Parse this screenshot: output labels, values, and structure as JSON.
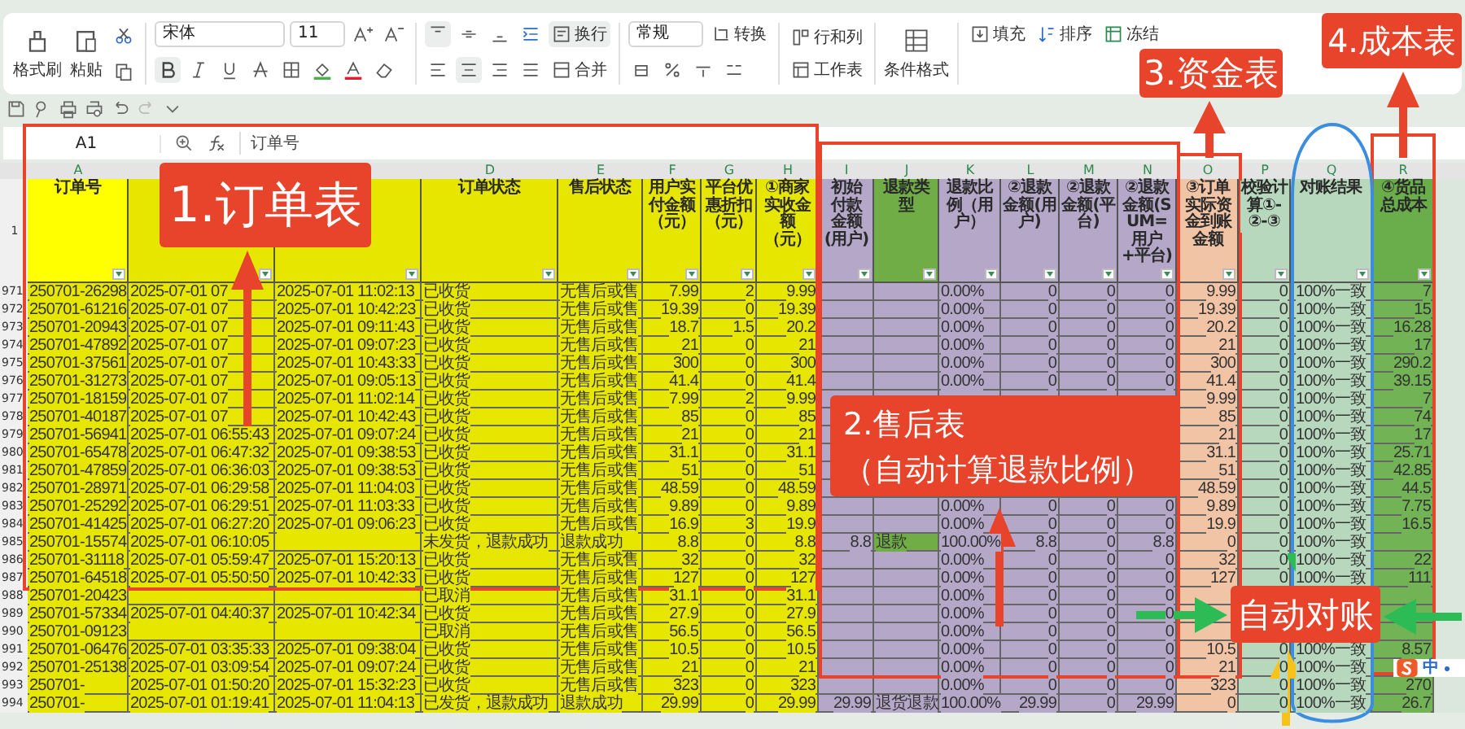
{
  "ribbon": {
    "format_painter": "格式刷",
    "paste": "粘贴",
    "font_name": "宋体",
    "font_size": "11",
    "wrap": "换行",
    "merge": "合并",
    "number_format": "常规",
    "convert": "转换",
    "rows_cols": "行和列",
    "worksheet": "工作表",
    "conditional": "条件格式",
    "fill": "填充",
    "sort": "排序",
    "freeze": "冻结"
  },
  "formula_bar": {
    "cell": "A1",
    "content": "订单号"
  },
  "sheet": {
    "header_row": "1",
    "columns": [
      {
        "letter": "A",
        "header": "订单号",
        "kind": "text"
      },
      {
        "kind": "text"
      },
      {
        "kind": "text"
      },
      {
        "letter": "D",
        "header": "订单状态",
        "kind": "text"
      },
      {
        "letter": "E",
        "header": "售后状态",
        "kind": "text"
      },
      {
        "letter": "F",
        "header": "用户实付金额（元）",
        "kind": "number"
      },
      {
        "letter": "G",
        "header": "平台优惠折扣（元）",
        "kind": "number"
      },
      {
        "letter": "H",
        "header": "①商家实收金额（元）",
        "kind": "number"
      },
      {
        "letter": "I",
        "header": "初始付款金额(用户)",
        "kind": "number"
      },
      {
        "letter": "J",
        "header": "退款类型",
        "kind": "text"
      },
      {
        "letter": "K",
        "header": "退款比例（用户）",
        "kind": "text"
      },
      {
        "letter": "L",
        "header": "②退款金额(用户)",
        "kind": "number"
      },
      {
        "letter": "M",
        "header": "②退款金额(平台)",
        "kind": "number"
      },
      {
        "letter": "N",
        "header": "②退款金额(SUM=用户+平台)",
        "kind": "number"
      },
      {
        "letter": "O",
        "header": "③订单实际资金到账金额",
        "kind": "number"
      },
      {
        "letter": "P",
        "header": "校验计算①-②-③",
        "kind": "number"
      },
      {
        "letter": "Q",
        "header": "对账结果",
        "kind": "text"
      },
      {
        "letter": "R",
        "header": "④货品总成本",
        "kind": "number"
      }
    ],
    "rows": [
      {
        "num": "971",
        "flagged": false,
        "cells": [
          "250701-26298",
          "2025-07-01 07",
          "2025-07-01 11:02:13",
          "已收货",
          "无售后或售",
          "7.99",
          "2",
          "9.99",
          null,
          null,
          "0.00%",
          "0",
          "0",
          "0",
          "9.99",
          "0",
          "100%一致",
          "7"
        ]
      },
      {
        "num": "972",
        "flagged": false,
        "cells": [
          "250701-61216",
          "2025-07-01 07",
          "2025-07-01 10:42:23",
          "已收货",
          "无售后或售",
          "19.39",
          "0",
          "19.39",
          null,
          null,
          "0.00%",
          "0",
          "0",
          "0",
          "19.39",
          "0",
          "100%一致",
          "15"
        ]
      },
      {
        "num": "973",
        "flagged": false,
        "cells": [
          "250701-20943",
          "2025-07-01 07",
          "2025-07-01 09:11:43",
          "已收货",
          "无售后或售",
          "18.7",
          "1.5",
          "20.2",
          null,
          null,
          "0.00%",
          "0",
          "0",
          "0",
          "20.2",
          "0",
          "100%一致",
          "16.28"
        ]
      },
      {
        "num": "974",
        "flagged": false,
        "cells": [
          "250701-47892",
          "2025-07-01 07",
          "2025-07-01 09:07:23",
          "已收货",
          "无售后或售",
          "21",
          "0",
          "21",
          null,
          null,
          "0.00%",
          "0",
          "0",
          "0",
          "21",
          "0",
          "100%一致",
          "17"
        ]
      },
      {
        "num": "975",
        "flagged": false,
        "cells": [
          "250701-37561",
          "2025-07-01 07",
          "2025-07-01 10:43:33",
          "已收货",
          "无售后或售",
          "300",
          "0",
          "300",
          null,
          null,
          "0.00%",
          "0",
          "0",
          "0",
          "300",
          "0",
          "100%一致",
          "290.2"
        ]
      },
      {
        "num": "976",
        "flagged": false,
        "cells": [
          "250701-31273",
          "2025-07-01 07",
          "2025-07-01 09:05:13",
          "已收货",
          "无售后或售",
          "41.4",
          "0",
          "41.4",
          null,
          null,
          "0.00%",
          "0",
          "0",
          "0",
          "41.4",
          "0",
          "100%一致",
          "39.15"
        ]
      },
      {
        "num": "977",
        "flagged": false,
        "cells": [
          "250701-18159",
          "2025-07-01 07",
          "2025-07-01 11:02:14",
          "已收货",
          "无售后或售",
          "7.99",
          "2",
          "9.99",
          null,
          null,
          null,
          null,
          null,
          null,
          "9.99",
          "0",
          "100%一致",
          "7"
        ]
      },
      {
        "num": "978",
        "cells": [
          "250701-40187",
          "2025-07-01 07",
          "2025-07-01 10:42:43",
          "已收货",
          "无售后或售",
          "85",
          "0",
          "85",
          null,
          null,
          null,
          null,
          null,
          null,
          "85",
          "0",
          "100%一致",
          "74"
        ]
      },
      {
        "num": "979",
        "cells": [
          "250701-56941",
          "2025-07-01 06:55:43",
          "2025-07-01 09:07:24",
          "已收货",
          "无售后或售",
          "21",
          "0",
          "21",
          null,
          null,
          null,
          null,
          null,
          null,
          "21",
          "0",
          "100%一致",
          "17"
        ]
      },
      {
        "num": "980",
        "cells": [
          "250701-65478",
          "2025-07-01 06:47:32",
          "2025-07-01 09:38:53",
          "已收货",
          "无售后或售",
          "31.1",
          "0",
          "31.1",
          null,
          null,
          null,
          null,
          null,
          null,
          "31.1",
          "0",
          "100%一致",
          "25.71"
        ]
      },
      {
        "num": "981",
        "cells": [
          "250701-47859",
          "2025-07-01 06:36:03",
          "2025-07-01 09:38:53",
          "已收货",
          "无售后或售",
          "51",
          "0",
          "51",
          null,
          null,
          null,
          null,
          null,
          null,
          "51",
          "0",
          "100%一致",
          "42.85"
        ]
      },
      {
        "num": "982",
        "cells": [
          "250701-28971",
          "2025-07-01 06:29:58",
          "2025-07-01 11:04:03",
          "已收货",
          "无售后或售",
          "48.59",
          "0",
          "48.59",
          null,
          null,
          null,
          null,
          null,
          null,
          "48.59",
          "0",
          "100%一致",
          "44.5"
        ]
      },
      {
        "num": "983",
        "flagged": false,
        "cells": [
          "250701-25292",
          "2025-07-01 06:29:51",
          "2025-07-01 11:03:33",
          "已收货",
          "无售后或售",
          "9.89",
          "0",
          "9.89",
          null,
          null,
          "0.00%",
          "0",
          "0",
          "0",
          "9.89",
          "0",
          "100%一致",
          "7.75"
        ]
      },
      {
        "num": "984",
        "flagged": false,
        "cells": [
          "250701-41425",
          "2025-07-01 06:27:20",
          "2025-07-01 09:06:23",
          "已收货",
          "无售后或售",
          "16.9",
          "3",
          "19.9",
          null,
          null,
          "0.00%",
          "0",
          "0",
          "0",
          "19.9",
          "0",
          "100%一致",
          "16.5"
        ]
      },
      {
        "num": "985",
        "flagged": true,
        "cells": [
          "250701-15574",
          "2025-07-01 06:10:05",
          null,
          "未发货，退款成功",
          "退款成功",
          "8.8",
          "0",
          "8.8",
          "8.8",
          "退款",
          "100.00%",
          "8.8",
          "0",
          "8.8",
          "0",
          "0",
          "100%一致",
          null
        ]
      },
      {
        "num": "986",
        "flagged": false,
        "cells": [
          "250701-31118",
          "2025-07-01 05:59:47",
          "2025-07-01 15:20:13",
          "已收货",
          "无售后或售",
          "32",
          "0",
          "32",
          null,
          null,
          "0.00%",
          "0",
          "0",
          "0",
          "32",
          "0",
          "100%一致",
          "22"
        ]
      },
      {
        "num": "987",
        "flagged": false,
        "cells": [
          "250701-64518",
          "2025-07-01 05:50:50",
          "2025-07-01 10:42:33",
          "已收货",
          "无售后或售",
          "127",
          "0",
          "127",
          null,
          null,
          "0.00%",
          "0",
          "0",
          "0",
          "127",
          "0",
          "100%一致",
          "111"
        ]
      },
      {
        "num": "988",
        "flagged": false,
        "cells": [
          "250701-20423",
          null,
          null,
          "已取消",
          "无售后或售",
          "31.1",
          "0",
          "31.1",
          null,
          null,
          "0.00%",
          "0",
          "0",
          "0",
          null,
          null,
          null,
          null
        ]
      },
      {
        "num": "989",
        "flagged": false,
        "cells": [
          "250701-57334",
          "2025-07-01 04:40:37",
          "2025-07-01 10:42:34",
          "已收货",
          "无售后或售",
          "27.9",
          "0",
          "27.9",
          null,
          null,
          "0.00%",
          "0",
          "0",
          "0",
          null,
          null,
          null,
          null
        ]
      },
      {
        "num": "990",
        "flagged": false,
        "cells": [
          "250701-09123",
          null,
          null,
          "已取消",
          "无售后或售",
          "56.5",
          "0",
          "56.5",
          null,
          null,
          "0.00%",
          "0",
          "0",
          "0",
          null,
          null,
          null,
          null
        ]
      },
      {
        "num": "991",
        "flagged": false,
        "cells": [
          "250701-06476",
          "2025-07-01 03:35:33",
          "2025-07-01 09:38:04",
          "已收货",
          "无售后或售",
          "10.5",
          "0",
          "10.5",
          null,
          null,
          "0.00%",
          "0",
          "0",
          "0",
          "10.5",
          "0",
          "100%一致",
          "8.57"
        ]
      },
      {
        "num": "992",
        "flagged": false,
        "cells": [
          "250701-25138",
          "2025-07-01 03:09:54",
          "2025-07-01 09:07:24",
          "已收货",
          "无售后或售",
          "21",
          "0",
          "21",
          null,
          null,
          "0.00%",
          "0",
          "0",
          "0",
          "21",
          "0",
          "100%一致",
          null
        ]
      },
      {
        "num": "993",
        "flagged": false,
        "cells": [
          "250701-",
          "2025-07-01 01:50:20",
          "2025-07-01 15:32:23",
          "已收货",
          "无售后或售",
          "323",
          "0",
          "323",
          null,
          null,
          "0.00%",
          "0",
          "0",
          "0",
          "323",
          "0",
          "100%一致",
          "270"
        ]
      },
      {
        "num": "994",
        "flagged": false,
        "cells": [
          "250701-",
          "2025-07-01 01:19:41",
          "2025-07-01 11:04:13",
          "已发货，退款成功",
          "退款成功",
          "29.99",
          "0",
          "29.99",
          "29.99",
          "退货退款",
          "100.00%",
          "29.99",
          "0",
          "29.99",
          "0",
          "0",
          "100%一致",
          "26.7"
        ]
      }
    ]
  },
  "annotations": [
    {
      "text": "1.订单表"
    },
    {
      "text": "2.售后表",
      "note": "（自动计算退款比例）"
    },
    {
      "text": "3.资金表"
    },
    {
      "text": "4.成本表"
    },
    {
      "text": "自动对账"
    }
  ],
  "ime": {
    "mode": "中"
  }
}
